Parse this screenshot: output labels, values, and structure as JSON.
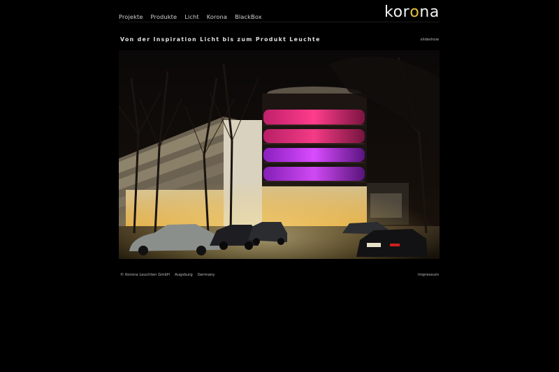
{
  "nav": {
    "items": [
      {
        "label": "Projekte"
      },
      {
        "label": "Produkte"
      },
      {
        "label": "Licht"
      },
      {
        "label": "Korona"
      },
      {
        "label": "BlackBox"
      }
    ]
  },
  "logo": {
    "text_pre": "kor",
    "text_o": "o",
    "text_post": "na",
    "accent_color": "#e8c23a"
  },
  "headline": {
    "tagline": "Von der Inspiration Licht bis zum Produkt Leuchte",
    "slideshow_link": "slideshow"
  },
  "photo": {
    "subject": "night-building-illuminated-photo"
  },
  "footer": {
    "company": "© Korona Leuchten GmbH",
    "city": "Augsburg",
    "country": "Germany",
    "impressum": "Impressum"
  }
}
